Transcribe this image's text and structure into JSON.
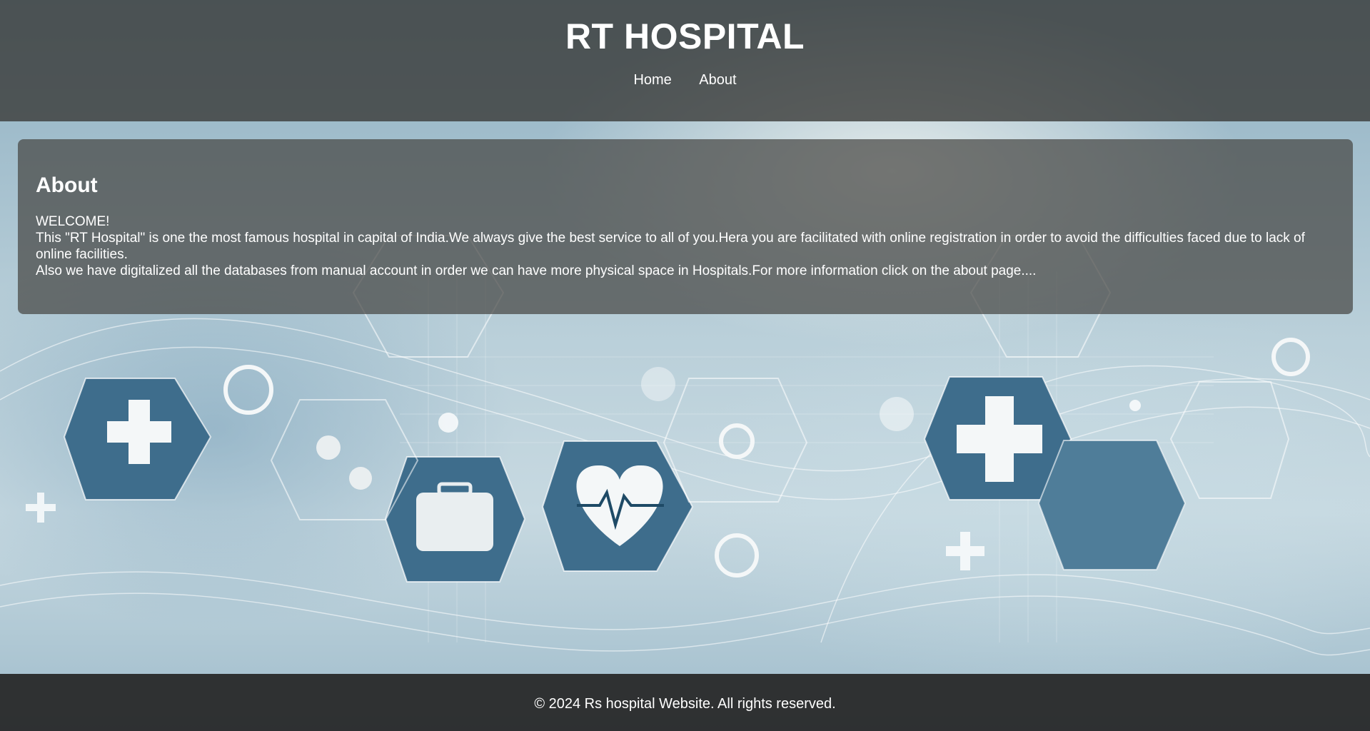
{
  "header": {
    "title": "RT HOSPITAL",
    "nav": [
      {
        "label": "Home"
      },
      {
        "label": "About"
      }
    ]
  },
  "about": {
    "heading": "About",
    "lines": [
      "WELCOME!",
      "This \"RT Hospital\" is one the most famous hospital in capital of India.We always give the best service to all of you.Hera you are facilitated with online registration in order to avoid the difficulties faced due to lack of online facilities.",
      "Also we have digitalized all the databases from manual account in order we can have more physical space in Hospitals.For more information click on the about page...."
    ]
  },
  "footer": {
    "text": "© 2024 Rs hospital Website. All rights reserved."
  },
  "colors": {
    "header_bg": "#373734",
    "panel_bg": "#464644",
    "footer_bg": "#262626",
    "text": "#ffffff",
    "accent_blue": "#3e6d8c"
  },
  "background_icons": [
    "star-of-life-icon",
    "plus-icon",
    "molecule-icon",
    "first-aid-kit-icon",
    "heartbeat-icon",
    "target-icon",
    "cross-icon",
    "stethoscope-icon",
    "caduceus-icon",
    "clock-icon",
    "power-icon"
  ]
}
